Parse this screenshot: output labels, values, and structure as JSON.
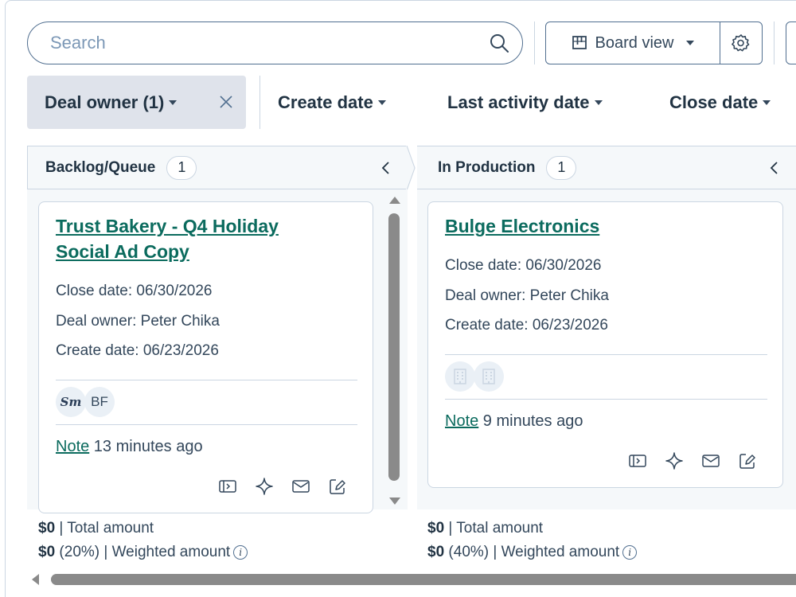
{
  "search": {
    "placeholder": "Search"
  },
  "toolbar": {
    "board_view_label": "Board view"
  },
  "filters": [
    {
      "label": "Deal owner (1)",
      "active": true
    },
    {
      "label": "Create date"
    },
    {
      "label": "Last activity date"
    },
    {
      "label": "Close date"
    }
  ],
  "columns": [
    {
      "name": "Backlog/Queue",
      "count": "1",
      "card": {
        "title_line1": "Trust Bakery - Q4 Holiday",
        "title_line2": "Social Ad Copy",
        "close_date": "Close date: 06/30/2026",
        "deal_owner": "Deal owner: Peter Chika",
        "create_date": "Create date: 06/23/2026",
        "avatar1": "Sm",
        "avatar2": "BF",
        "note_link": "Note",
        "note_time": " 13 minutes ago"
      },
      "total_value": "$0",
      "total_label": " | Total amount",
      "weighted_value": "$0",
      "weighted_label": " (20%) | Weighted amount"
    },
    {
      "name": "In Production",
      "count": "1",
      "card": {
        "title": "Bulge Electronics",
        "close_date": "Close date: 06/30/2026",
        "deal_owner": "Deal owner: Peter Chika",
        "create_date": "Create date: 06/23/2026",
        "note_link": "Note",
        "note_time": " 9 minutes ago"
      },
      "total_value": "$0",
      "total_label": " | Total amount",
      "weighted_value": "$0",
      "weighted_label": " (40%) | Weighted amount"
    }
  ],
  "info_glyph": "i",
  "icons": [
    "search-icon",
    "board-icon",
    "gear-icon",
    "close-icon",
    "chevron-left-icon",
    "preview-icon",
    "sparkle-icon",
    "email-icon",
    "edit-note-icon",
    "info-icon",
    "company-icon"
  ]
}
